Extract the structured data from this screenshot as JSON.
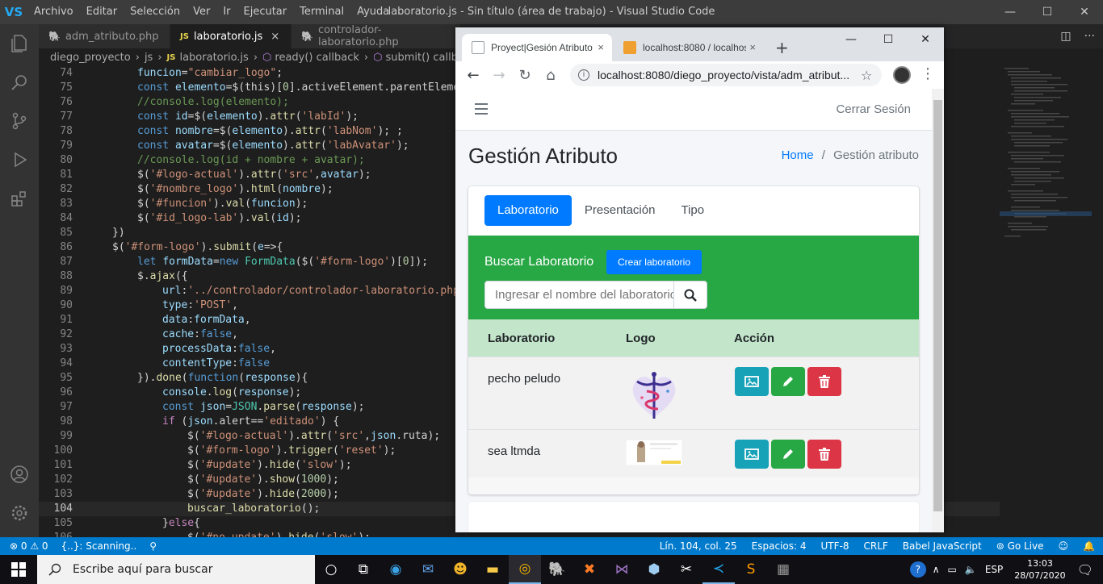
{
  "vscode": {
    "logo": "VS",
    "menu": [
      "Archivo",
      "Editar",
      "Selección",
      "Ver",
      "Ir",
      "Ejecutar",
      "Terminal",
      "Ayuda"
    ],
    "window_title": "laboratorio.js - Sin título (área de trabajo) - Visual Studio Code",
    "tabs": [
      {
        "label": "adm_atributo.php",
        "icon": "php-icon"
      },
      {
        "label": "laboratorio.js",
        "icon": "js-icon",
        "close": "×"
      },
      {
        "label": "controlador-laboratorio.php",
        "icon": "php-icon"
      }
    ],
    "breadcrumb": [
      "diego_proyecto",
      "js",
      "laboratorio.js",
      "ready() callback",
      "submit() callback"
    ],
    "code_lines": [
      {
        "n": "74",
        "text": "funcion=\"cambiar_logo\";"
      },
      {
        "n": "75",
        "text": "const elemento=$(this)[0].activeElement.parentEleme"
      },
      {
        "n": "76",
        "text": "//console.log(elemento);"
      },
      {
        "n": "77",
        "text": "const id=$(elemento).attr('labId');"
      },
      {
        "n": "78",
        "text": "const nombre=$(elemento).attr('labNom'); ;"
      },
      {
        "n": "79",
        "text": "const avatar=$(elemento).attr('labAvatar');"
      },
      {
        "n": "80",
        "text": "//console.log(id + nombre + avatar);"
      },
      {
        "n": "81",
        "text": "$('#logo-actual').attr('src',avatar);"
      },
      {
        "n": "82",
        "text": "$('#nombre_logo').html(nombre);"
      },
      {
        "n": "83",
        "text": "$('#funcion').val(funcion);"
      },
      {
        "n": "84",
        "text": "$('#id_logo-lab').val(id);"
      },
      {
        "n": "85",
        "text": "})"
      },
      {
        "n": "86",
        "text": "$('#form-logo').submit(e=>{"
      },
      {
        "n": "87",
        "text": "let formData=new FormData($('#form-logo')[0]);"
      },
      {
        "n": "88",
        "text": "$.ajax({"
      },
      {
        "n": "89",
        "text": "url:'../controlador/controlador-laboratorio.php"
      },
      {
        "n": "90",
        "text": "type:'POST',"
      },
      {
        "n": "91",
        "text": "data:formData,"
      },
      {
        "n": "92",
        "text": "cache:false,"
      },
      {
        "n": "93",
        "text": "processData:false,"
      },
      {
        "n": "94",
        "text": "contentType:false"
      },
      {
        "n": "95",
        "text": "}).done(function(response){"
      },
      {
        "n": "96",
        "text": "console.log(response);"
      },
      {
        "n": "97",
        "text": "const json=JSON.parse(response);"
      },
      {
        "n": "98",
        "text": "if (json.alert=='editado') {"
      },
      {
        "n": "99",
        "text": "$('#logo-actual').attr('src',json.ruta);"
      },
      {
        "n": "100",
        "text": "$('#form-logo').trigger('reset');"
      },
      {
        "n": "101",
        "text": "$('#update').hide('slow');"
      },
      {
        "n": "102",
        "text": "$('#update').show(1000);"
      },
      {
        "n": "103",
        "text": "$('#update').hide(2000);"
      },
      {
        "n": "104",
        "text": "buscar_laboratorio();"
      },
      {
        "n": "105",
        "text": "}else{"
      },
      {
        "n": "106",
        "text": "$('#no-update').hide('slow');"
      }
    ],
    "status": {
      "problems": "⊗ 0 ⚠ 0",
      "scanning": "{..}: Scanning..",
      "position": "Lín. 104, col. 25",
      "spaces": "Espacios: 4",
      "encoding": "UTF-8",
      "eol": "CRLF",
      "language": "Babel JavaScript",
      "golive": "Go Live"
    }
  },
  "taskbar": {
    "search_placeholder": "Escribe aquí para buscar",
    "lang": "ESP",
    "time": "13:03",
    "date": "28/07/2020"
  },
  "browser": {
    "tabs": [
      {
        "title": "Proyect|Gesión Atributo",
        "close": "×"
      },
      {
        "title": "localhost:8080 / localhost",
        "close": "×"
      }
    ],
    "url": "localhost:8080/diego_proyecto/vista/adm_atribut..."
  },
  "page": {
    "logout": "Cerrar Sesión",
    "title": "Gestión Atributo",
    "breadcrumb_home": "Home",
    "breadcrumb_sep": "/",
    "breadcrumb_current": "Gestión atributo",
    "tabs": [
      "Laboratorio",
      "Presentación",
      "Tipo"
    ],
    "search_title": "Buscar Laboratorio",
    "create_button": "Crear laboratorio",
    "search_placeholder": "Ingresar el nombre del laboratorio",
    "columns": [
      "Laboratorio",
      "Logo",
      "Acción"
    ],
    "rows": [
      {
        "name": "pecho peludo"
      },
      {
        "name": "sea ltmda"
      }
    ],
    "colors": {
      "primary": "#007bff",
      "success": "#28a745",
      "info": "#17a2b8",
      "danger": "#dc3545"
    }
  }
}
